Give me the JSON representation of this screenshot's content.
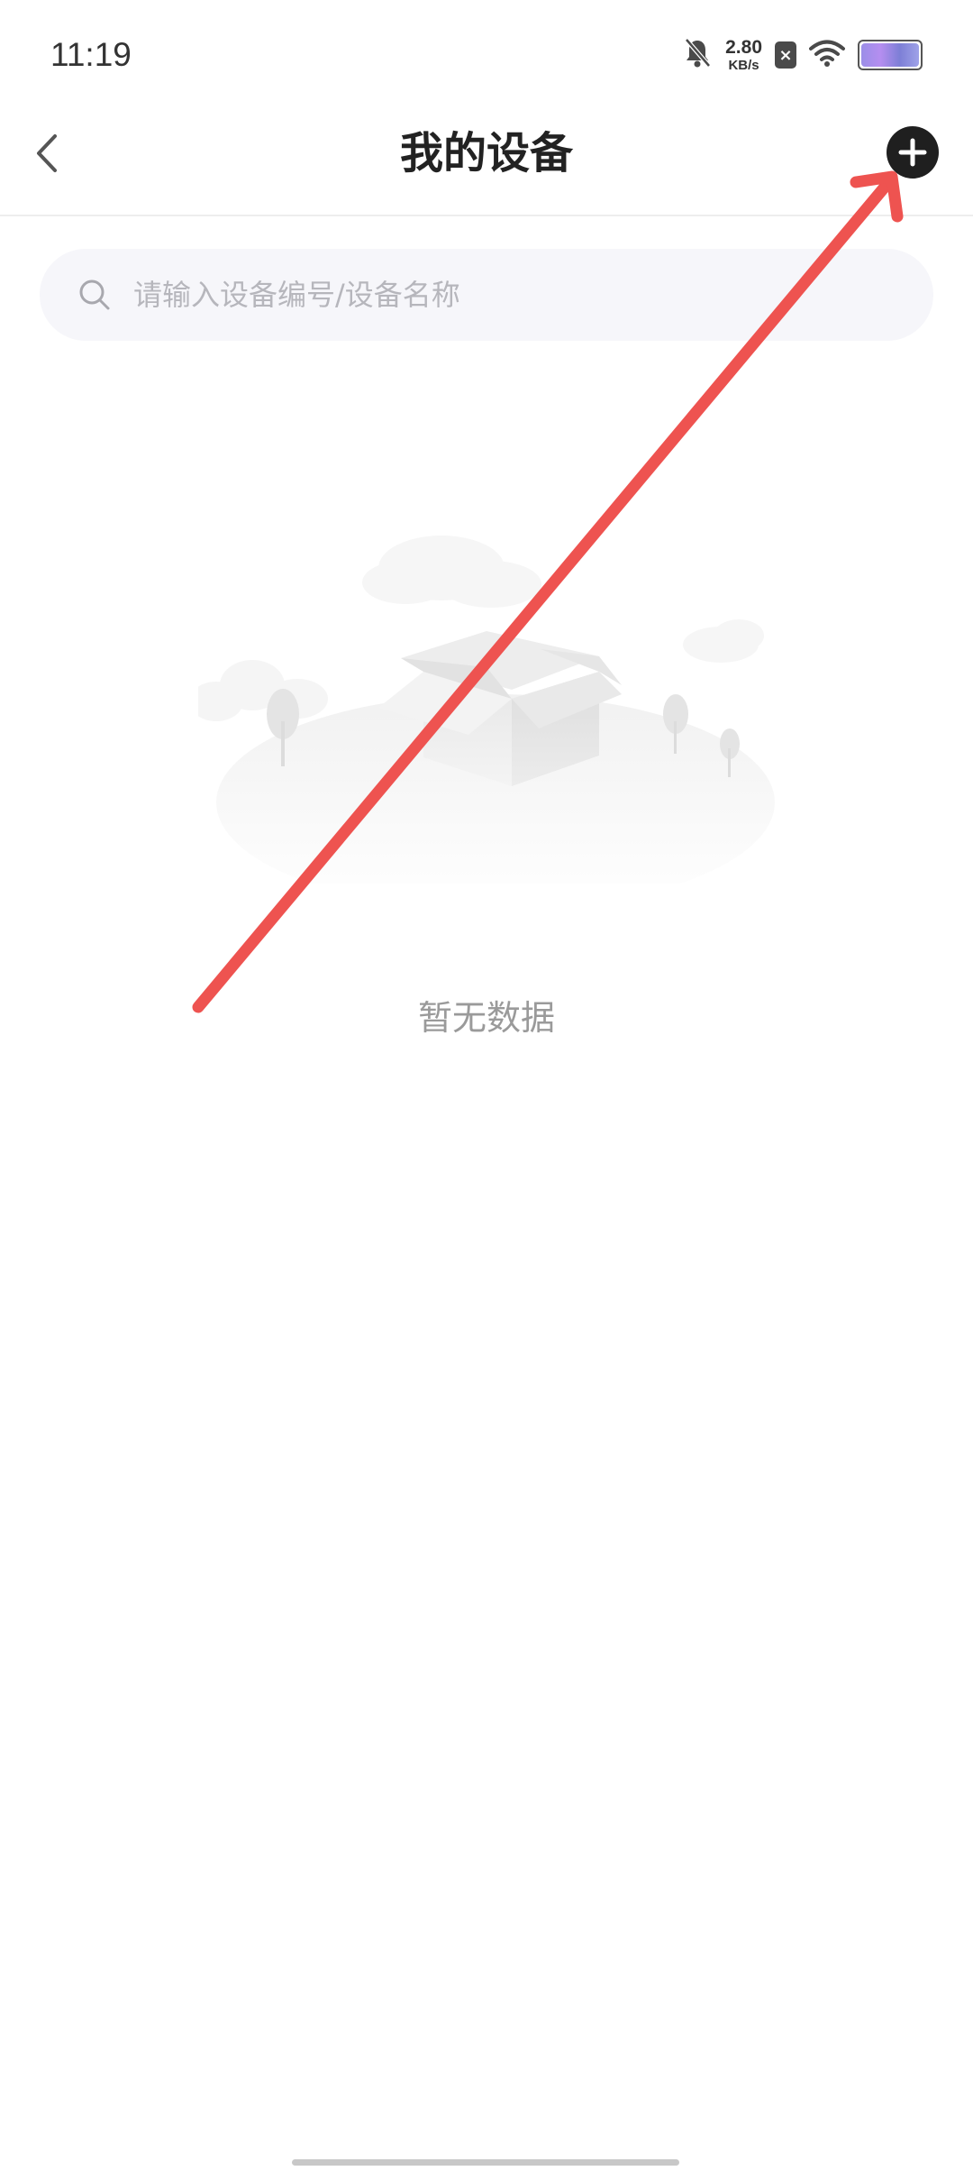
{
  "status_bar": {
    "time": "11:19",
    "net_speed_value": "2.80",
    "net_speed_unit": "KB/s",
    "sim_badge": "×",
    "icons": [
      "mute-bell-icon",
      "sim-off-icon",
      "wifi-icon",
      "battery-icon"
    ]
  },
  "header": {
    "title": "我的设备",
    "back_icon": "chevron-left-icon",
    "add_icon": "plus-circle-icon"
  },
  "search": {
    "placeholder": "请输入设备编号/设备名称",
    "value": "",
    "icon": "search-icon"
  },
  "empty_state": {
    "illustration": "empty-box-illustration",
    "message": "暂无数据"
  },
  "annotation": {
    "color": "#ee5350",
    "icon": "arrow-annotation"
  },
  "colors": {
    "background": "#ffffff",
    "title": "#222222",
    "search_bg": "#f6f6fa",
    "placeholder": "#b6b6bc",
    "empty_text": "#9a9a9a"
  }
}
